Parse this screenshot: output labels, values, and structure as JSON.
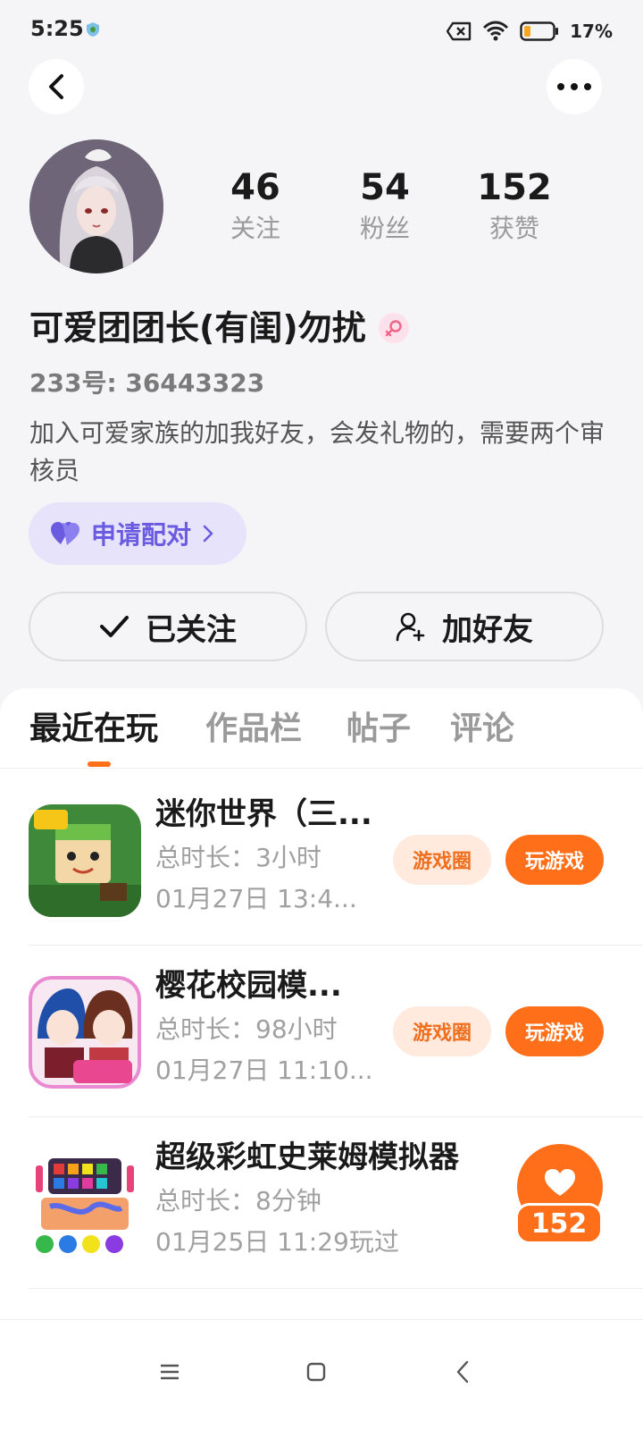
{
  "status_bar": {
    "time": "5:25",
    "battery": "17%"
  },
  "profile": {
    "stats": [
      {
        "value": "46",
        "label": "关注"
      },
      {
        "value": "54",
        "label": "粉丝"
      },
      {
        "value": "152",
        "label": "获赞"
      }
    ],
    "nickname": "可爱团团长(有闺)勿扰",
    "uid": "233号: 36443323",
    "bio": "加入可爱家族的加我好友，会发礼物的，需要两个审核员",
    "pair_button": "申请配对",
    "follow_button": "已关注",
    "add_friend_button": "加好友"
  },
  "tabs": [
    {
      "label": "最近在玩",
      "active": true
    },
    {
      "label": "作品栏",
      "active": false
    },
    {
      "label": "帖子",
      "active": false
    },
    {
      "label": "评论",
      "active": false
    }
  ],
  "games": [
    {
      "title": "迷你世界（三...",
      "duration": "总时长：3小时",
      "last_played": "01月27日 13:4...",
      "circle_label": "游戏圈",
      "play_label": "玩游戏"
    },
    {
      "title": "樱花校园模...",
      "duration": "总时长：98小时",
      "last_played": "01月27日 11:10...",
      "circle_label": "游戏圈",
      "play_label": "玩游戏"
    },
    {
      "title": "超级彩虹史莱姆模拟器",
      "duration": "总时长：8分钟",
      "last_played": "01月25日 11:29玩过"
    }
  ],
  "like_widget": {
    "count": "152"
  },
  "colors": {
    "accent": "#ff6f1a",
    "pair_bg": "#e6e3fb",
    "pair_text": "#6a5be0"
  },
  "icons": [
    "back-icon",
    "more-icon",
    "heart-pair-icon",
    "chevron-right-icon",
    "check-icon",
    "add-friend-icon",
    "heart-icon",
    "menu-icon",
    "home-icon",
    "nav-back-icon"
  ]
}
